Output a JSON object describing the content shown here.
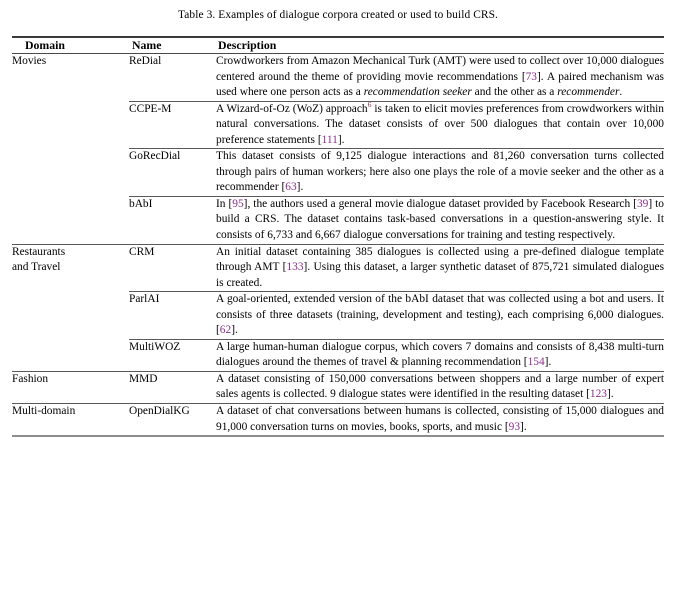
{
  "caption": "Table 3.  Examples of dialogue corpora created or used to build CRS.",
  "colors": {
    "citation": "#8b2f8b",
    "footnote_marker": "#8a2f3d",
    "rule": "#4a4a4a",
    "text": "#000000"
  },
  "table": {
    "headers": {
      "domain": "Domain",
      "name": "Name",
      "description": "Description"
    },
    "groups": [
      {
        "domain": "Movies",
        "rows": [
          {
            "name": "ReDial",
            "description": "Crowdworkers from Amazon Mechanical Turk (AMT) were used to collect over 10,000 dialogues centered around the theme of providing movie recommendations [73]. A paired mechanism was used where one person acts as a recommendation seeker and the other as a recommender.",
            "citations": [
              "73"
            ],
            "italics": [
              "recommendation seeker",
              "recommender"
            ]
          },
          {
            "name": "CCPE-M",
            "description": "A Wizard-of-Oz (WoZ) approach6 is taken to elicit movies preferences from crowdworkers within natural conversations. The dataset consists of over 500 dialogues that contain over 10,000 preference statements [111].",
            "citations": [
              "111"
            ],
            "footnote_marker": "6"
          },
          {
            "name": "GoRecDial",
            "description": "This dataset consists of 9,125 dialogue interactions and 81,260 conversation turns collected through pairs of human workers; here also one plays the role of a movie seeker and the other as a recommender [63].",
            "citations": [
              "63"
            ]
          },
          {
            "name": "bAbI",
            "description": "In [95], the authors used a general movie dialogue dataset provided by Facebook Research [39] to build a CRS. The dataset contains task-based conversations in a question-answering style. It consists of 6,733 and 6,667 dialogue conversations for training and testing respectively.",
            "citations": [
              "95",
              "39"
            ]
          }
        ]
      },
      {
        "domain": "Restaurants and Travel",
        "rows": [
          {
            "name": "CRM",
            "description": "An initial dataset containing 385 dialogues is collected using a pre-defined dialogue template through AMT [133]. Using this dataset, a larger synthetic dataset of 875,721 simulated dialogues is created.",
            "citations": [
              "133"
            ]
          },
          {
            "name": "ParlAI",
            "description": "A goal-oriented, extended version of the bAbI dataset that was collected using a bot and users. It consists of three datasets (training, development and testing), each comprising 6,000 dialogues. [62].",
            "citations": [
              "62"
            ]
          },
          {
            "name": "MultiWOZ",
            "description": "A large human-human dialogue corpus, which covers 7 domains and consists of 8,438 multi-turn dialogues around the themes of travel & planning recommendation [154].",
            "citations": [
              "154"
            ]
          }
        ]
      },
      {
        "domain": "Fashion",
        "rows": [
          {
            "name": "MMD",
            "description": "A dataset consisting of 150,000 conversations between shoppers and a large number of expert sales agents is collected. 9 dialogue states were identified in the resulting dataset [123].",
            "citations": [
              "123"
            ]
          }
        ]
      },
      {
        "domain": "Multi-domain",
        "rows": [
          {
            "name": "OpenDialKG",
            "description": "A dataset of chat conversations between humans is collected, consisting of 15,000 dialogues and 91,000 conversation turns on movies, books, sports, and music [93].",
            "citations": [
              "93"
            ]
          }
        ]
      }
    ]
  }
}
